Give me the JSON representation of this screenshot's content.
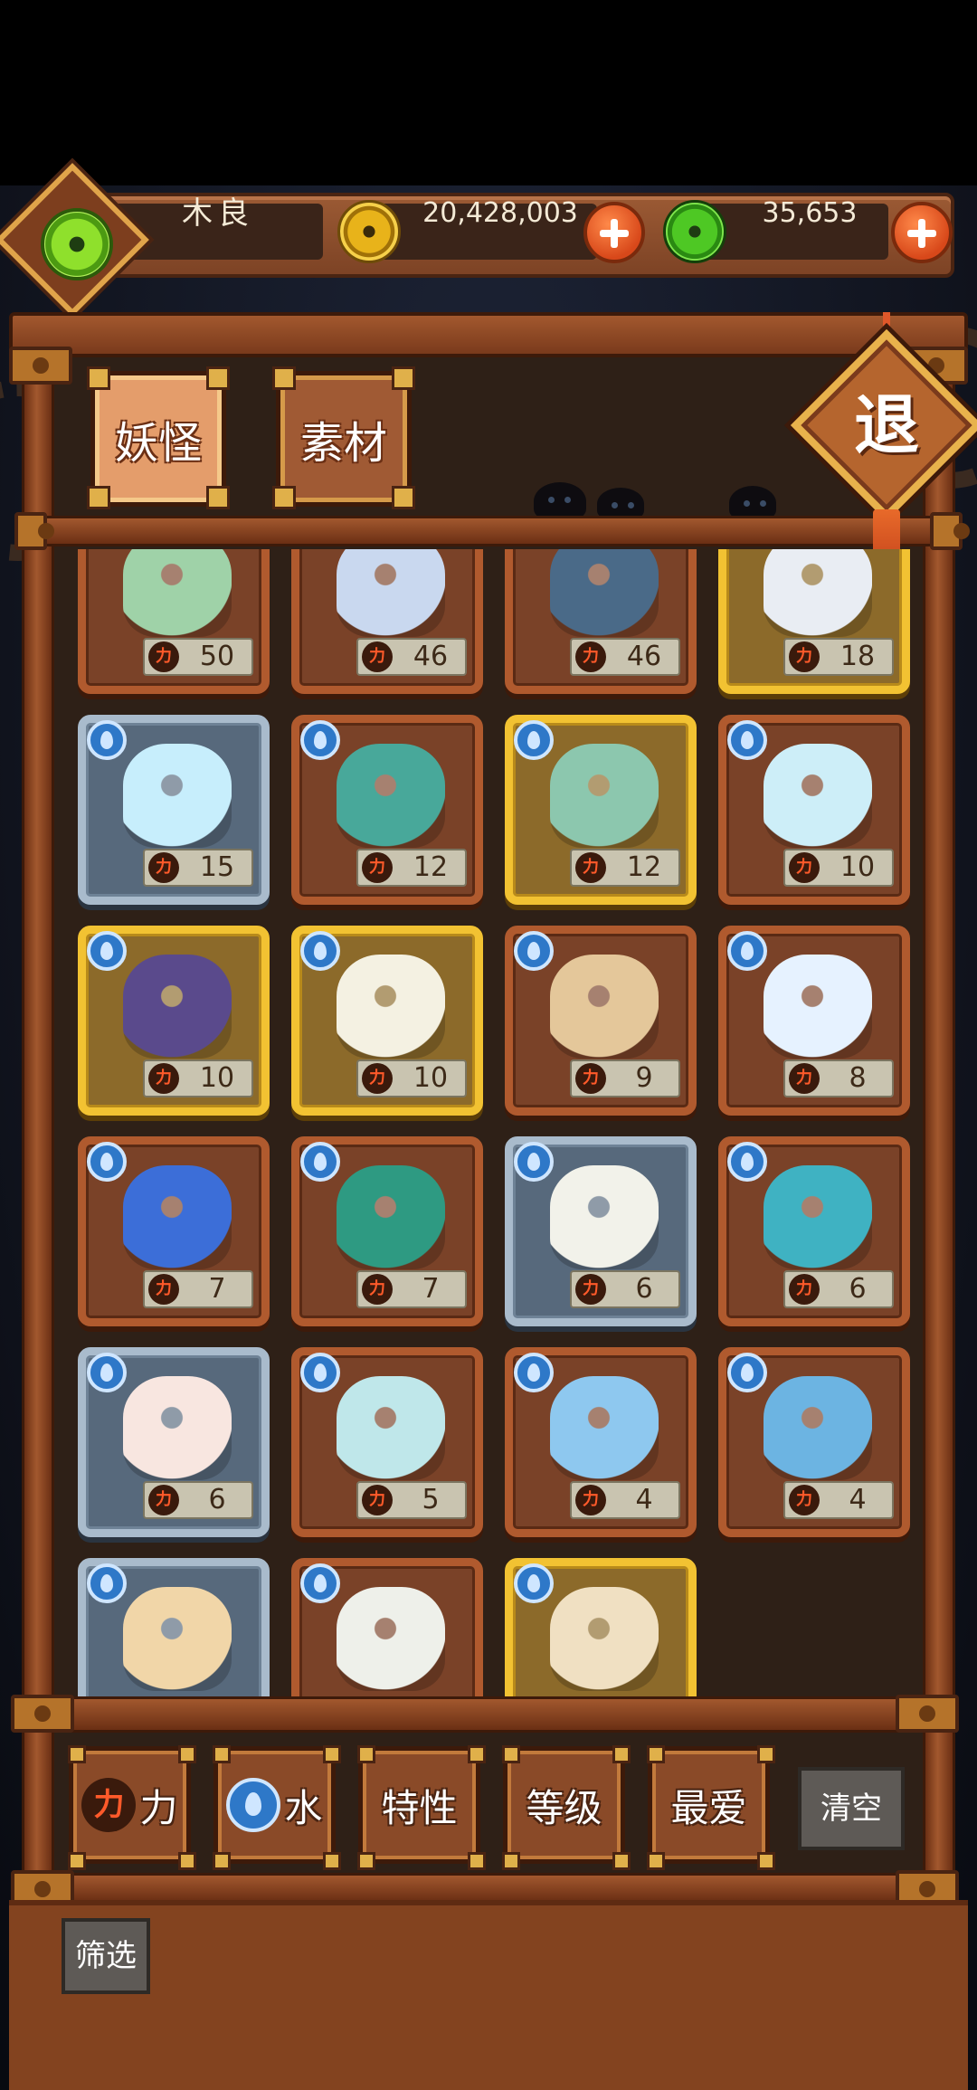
{
  "player": {
    "name": "木良"
  },
  "currency": {
    "gold": "20,428,003",
    "jade": "35,653"
  },
  "tabs": [
    {
      "label": "妖怪",
      "active": true
    },
    {
      "label": "素材",
      "active": false
    }
  ],
  "exit": {
    "label": "退"
  },
  "items": [
    {
      "count": "50",
      "rarity": "bronze",
      "art": "elder-demon",
      "color": "#9fd2a8"
    },
    {
      "count": "46",
      "rarity": "bronze",
      "art": "scholar",
      "color": "#c9d8ef"
    },
    {
      "count": "46",
      "rarity": "bronze",
      "art": "hat-fisherman",
      "color": "#4a6a88"
    },
    {
      "count": "18",
      "rarity": "gold",
      "art": "crown",
      "color": "#e9edf3"
    },
    {
      "count": "15",
      "rarity": "silver",
      "art": "fishbowl",
      "color": "#c7eefc"
    },
    {
      "count": "12",
      "rarity": "bronze",
      "art": "leaf-whirlpool",
      "color": "#48a89a"
    },
    {
      "count": "12",
      "rarity": "gold",
      "art": "vase-sprout",
      "color": "#8cc7ae"
    },
    {
      "count": "10",
      "rarity": "bronze",
      "art": "ice-cube",
      "color": "#cdeef8"
    },
    {
      "count": "10",
      "rarity": "gold",
      "art": "kettle",
      "color": "#5a4a8c"
    },
    {
      "count": "10",
      "rarity": "gold",
      "art": "white-flower",
      "color": "#f4f1e2"
    },
    {
      "count": "9",
      "rarity": "bronze",
      "art": "wood-log",
      "color": "#e4c79a"
    },
    {
      "count": "8",
      "rarity": "bronze",
      "art": "anemone",
      "color": "#e6f2ff"
    },
    {
      "count": "7",
      "rarity": "bronze",
      "art": "sea-slug",
      "color": "#3c6ed8"
    },
    {
      "count": "7",
      "rarity": "bronze",
      "art": "sprout-creature",
      "color": "#2e9a82"
    },
    {
      "count": "6",
      "rarity": "silver",
      "art": "mahjong-tile",
      "color": "#f2f2ea"
    },
    {
      "count": "6",
      "rarity": "bronze",
      "art": "sea-dragon",
      "color": "#3fb2c2"
    },
    {
      "count": "6",
      "rarity": "silver",
      "art": "topknot-baby",
      "color": "#f8e6e0"
    },
    {
      "count": "5",
      "rarity": "bronze",
      "art": "rice-bucket",
      "color": "#bfe7ea"
    },
    {
      "count": "4",
      "rarity": "bronze",
      "art": "blue-blob",
      "color": "#8ec8ef"
    },
    {
      "count": "4",
      "rarity": "bronze",
      "art": "puddle-fish",
      "color": "#6cb4e2"
    },
    {
      "count": "",
      "rarity": "silver",
      "art": "fishing-boy",
      "color": "#f1d6a8"
    },
    {
      "count": "",
      "rarity": "bronze",
      "art": "mahjong-dot",
      "color": "#eef0ea"
    },
    {
      "count": "",
      "rarity": "gold",
      "art": "torch-hand",
      "color": "#f0e0c2"
    }
  ],
  "power_icon": "力",
  "filters": [
    {
      "label": "力",
      "icon": "power-icon"
    },
    {
      "label": "水",
      "icon": "water-drop-icon"
    },
    {
      "label": "特性",
      "icon": ""
    },
    {
      "label": "等级",
      "icon": ""
    },
    {
      "label": "最爱",
      "icon": ""
    }
  ],
  "clear_label": "清空",
  "screen_label": "筛选"
}
